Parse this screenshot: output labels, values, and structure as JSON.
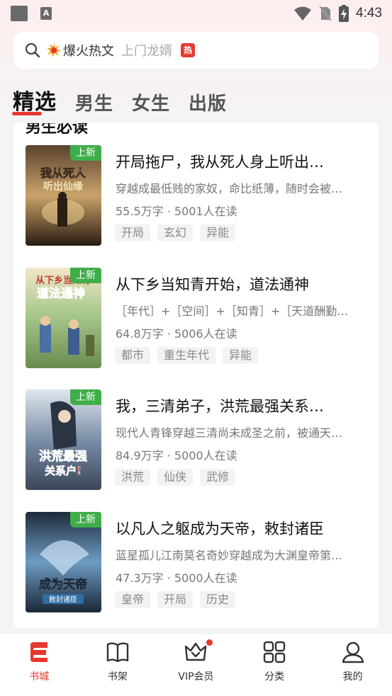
{
  "status_bar": {
    "time": "4:43",
    "app_icon_letter": "A"
  },
  "search": {
    "hot_label": "爆火热文",
    "placeholder": "上门龙婿",
    "hot_badge": "热"
  },
  "tabs": [
    {
      "label": "精选",
      "active": true
    },
    {
      "label": "男生",
      "active": false
    },
    {
      "label": "女生",
      "active": false
    },
    {
      "label": "出版",
      "active": false
    }
  ],
  "section": {
    "title": "男生必读"
  },
  "books": [
    {
      "badge": "上新",
      "title": "开局拖尸，我从死人身上听出…",
      "desc": "穿越成最低贱的家奴，命比纸薄，随时会被…",
      "meta": "55.5万字 · 5001人在读",
      "tags": [
        "开局",
        "玄幻",
        "异能"
      ],
      "cover_color": "#3a2a1e"
    },
    {
      "badge": "上新",
      "title": "从下乡当知青开始，道法通神",
      "desc": "［年代］+［空间］+［知青］+［天道酬勤…",
      "meta": "64.8万字 · 5006人在读",
      "tags": [
        "都市",
        "重生年代",
        "异能"
      ],
      "cover_color": "#8fb37a"
    },
    {
      "badge": "上新",
      "title": "我，三清弟子，洪荒最强关系…",
      "desc": "现代人青锋穿越三清尚未成圣之前，被通天…",
      "meta": "84.9万字 · 5000人在读",
      "tags": [
        "洪荒",
        "仙侠",
        "武修"
      ],
      "cover_color": "#5b6f8a"
    },
    {
      "badge": "上新",
      "title": "以凡人之躯成为天帝，敕封诸臣",
      "desc": "蓝星孤儿江南莫名奇妙穿越成为大渊皇帝第…",
      "meta": "47.3万字 · 5000人在读",
      "tags": [
        "皇帝",
        "开局",
        "历史"
      ],
      "cover_color": "#3d5a78"
    }
  ],
  "bottom_nav": [
    {
      "label": "书城",
      "icon": "bookstore-icon",
      "active": true
    },
    {
      "label": "书架",
      "icon": "bookshelf-icon",
      "active": false
    },
    {
      "label": "VIP会员",
      "icon": "vip-crown-icon",
      "active": false
    },
    {
      "label": "分类",
      "icon": "category-grid-icon",
      "active": false
    },
    {
      "label": "我的",
      "icon": "profile-icon",
      "active": false
    }
  ],
  "colors": {
    "accent": "#e8372c",
    "new_badge": "#3fae49"
  }
}
